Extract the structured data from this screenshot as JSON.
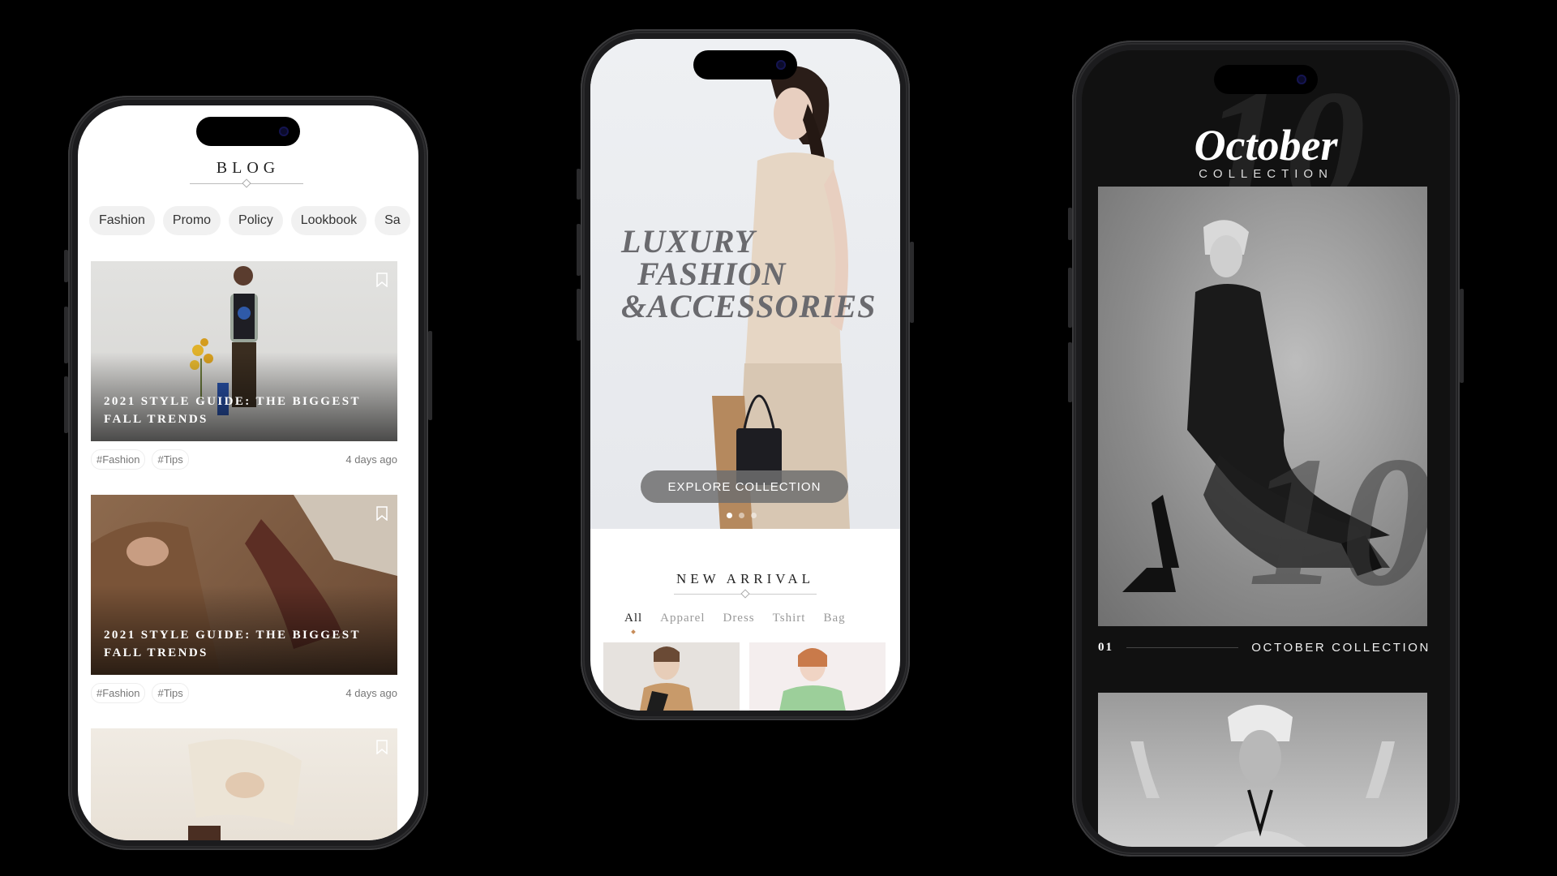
{
  "blog": {
    "title": "BLOG",
    "chips": [
      "Fashion",
      "Promo",
      "Policy",
      "Lookbook",
      "Sa"
    ],
    "posts": [
      {
        "title": "2021 STYLE GUIDE: THE BIGGEST FALL TRENDS",
        "tags": [
          "#Fashion",
          "#Tips"
        ],
        "ago": "4 days ago"
      },
      {
        "title": "2021 STYLE GUIDE: THE BIGGEST FALL TRENDS",
        "tags": [
          "#Fashion",
          "#Tips"
        ],
        "ago": "4 days ago"
      }
    ]
  },
  "luxury": {
    "hero_lines": [
      "LUXURY",
      "FASHION",
      "&ACCESSORIES"
    ],
    "cta": "EXPLORE COLLECTION",
    "new_arrival_title": "NEW ARRIVAL",
    "filters": [
      "All",
      "Apparel",
      "Dress",
      "Tshirt",
      "Bag"
    ]
  },
  "october": {
    "title": "October",
    "subtitle": "COLLECTION",
    "bg_numeral": "10",
    "index": "01",
    "label": "OCTOBER COLLECTION"
  },
  "colors": {
    "accent": "#c78d5a",
    "dark_bg": "#111111"
  }
}
